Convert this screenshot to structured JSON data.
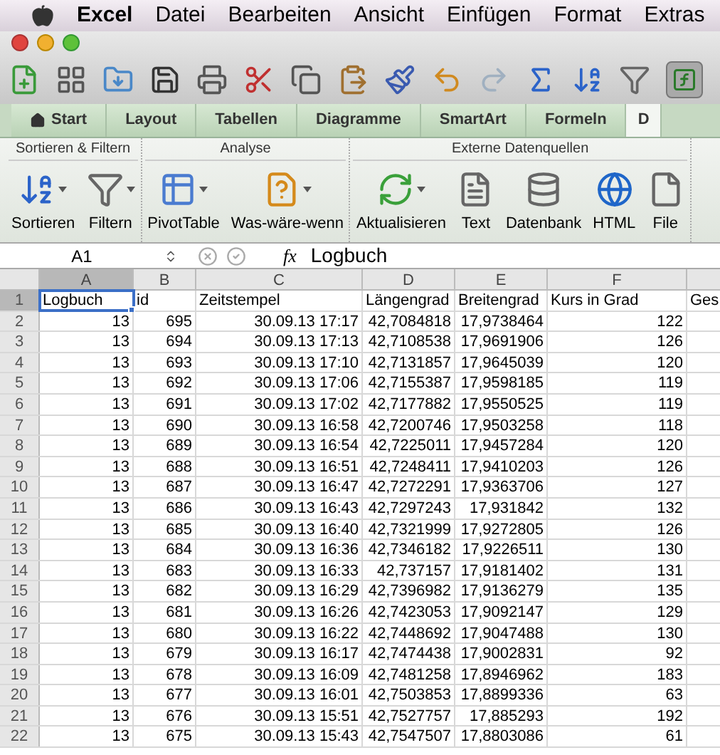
{
  "menu_bar": {
    "app": "Excel",
    "items": [
      "Datei",
      "Bearbeiten",
      "Ansicht",
      "Einfügen",
      "Format",
      "Extras"
    ]
  },
  "ribbon_tabs": [
    {
      "label": "Start",
      "kind": "home",
      "selected": false
    },
    {
      "label": "Layout",
      "kind": "plain",
      "selected": false
    },
    {
      "label": "Tabellen",
      "kind": "plain",
      "selected": false
    },
    {
      "label": "Diagramme",
      "kind": "plain",
      "selected": false
    },
    {
      "label": "SmartArt",
      "kind": "plain",
      "selected": false
    },
    {
      "label": "Formeln",
      "kind": "plain",
      "selected": false
    },
    {
      "label": "D",
      "kind": "plain",
      "selected": true
    }
  ],
  "ribbon_groups": [
    {
      "title": "Sortieren & Filtern",
      "buttons": [
        {
          "label": "Sortieren",
          "kind": "sort",
          "dropdown": true
        },
        {
          "label": "Filtern",
          "kind": "filter",
          "dropdown": true
        }
      ]
    },
    {
      "title": "Analyse",
      "buttons": [
        {
          "label": "PivotTable",
          "kind": "pivot",
          "dropdown": true
        },
        {
          "label": "Was-wäre-wenn",
          "kind": "whatif",
          "dropdown": true
        }
      ]
    },
    {
      "title": "Externe Datenquellen",
      "buttons": [
        {
          "label": "Aktualisieren",
          "kind": "refresh",
          "dropdown": true
        },
        {
          "label": "Text",
          "kind": "text",
          "dropdown": false
        },
        {
          "label": "Datenbank",
          "kind": "database",
          "dropdown": false
        },
        {
          "label": "HTML",
          "kind": "html",
          "dropdown": false
        },
        {
          "label": "File",
          "kind": "file",
          "dropdown": false
        }
      ]
    }
  ],
  "formula_bar": {
    "cell_ref": "A1",
    "function_label": "fx",
    "value": "Logbuch"
  },
  "sheet": {
    "columns": [
      {
        "letter": "A",
        "selected": true
      },
      {
        "letter": "B",
        "selected": false
      },
      {
        "letter": "C",
        "selected": false
      },
      {
        "letter": "D",
        "selected": false
      },
      {
        "letter": "E",
        "selected": false
      },
      {
        "letter": "F",
        "selected": false
      }
    ],
    "rows": [
      {
        "number": "1",
        "selected": true,
        "kind": "text",
        "cells": [
          "Logbuch",
          "id",
          "Zeitstempel",
          "Längengrad",
          "Breitengrad",
          "Kurs in Grad",
          "Ges"
        ]
      },
      {
        "number": "2",
        "selected": false,
        "kind": "number",
        "cells": [
          "13",
          "695",
          "30.09.13 17:17",
          "42,7084818",
          "17,9738464",
          "122"
        ]
      },
      {
        "number": "3",
        "selected": false,
        "kind": "number",
        "cells": [
          "13",
          "694",
          "30.09.13 17:13",
          "42,7108538",
          "17,9691906",
          "126"
        ]
      },
      {
        "number": "4",
        "selected": false,
        "kind": "number",
        "cells": [
          "13",
          "693",
          "30.09.13 17:10",
          "42,7131857",
          "17,9645039",
          "120"
        ]
      },
      {
        "number": "5",
        "selected": false,
        "kind": "number",
        "cells": [
          "13",
          "692",
          "30.09.13 17:06",
          "42,7155387",
          "17,9598185",
          "119"
        ]
      },
      {
        "number": "6",
        "selected": false,
        "kind": "number",
        "cells": [
          "13",
          "691",
          "30.09.13 17:02",
          "42,7177882",
          "17,9550525",
          "119"
        ]
      },
      {
        "number": "7",
        "selected": false,
        "kind": "number",
        "cells": [
          "13",
          "690",
          "30.09.13 16:58",
          "42,7200746",
          "17,9503258",
          "118"
        ]
      },
      {
        "number": "8",
        "selected": false,
        "kind": "number",
        "cells": [
          "13",
          "689",
          "30.09.13 16:54",
          "42,7225011",
          "17,9457284",
          "120"
        ]
      },
      {
        "number": "9",
        "selected": false,
        "kind": "number",
        "cells": [
          "13",
          "688",
          "30.09.13 16:51",
          "42,7248411",
          "17,9410203",
          "126"
        ]
      },
      {
        "number": "10",
        "selected": false,
        "kind": "number",
        "cells": [
          "13",
          "687",
          "30.09.13 16:47",
          "42,7272291",
          "17,9363706",
          "127"
        ]
      },
      {
        "number": "11",
        "selected": false,
        "kind": "number",
        "cells": [
          "13",
          "686",
          "30.09.13 16:43",
          "42,7297243",
          "17,931842",
          "132"
        ]
      },
      {
        "number": "12",
        "selected": false,
        "kind": "number",
        "cells": [
          "13",
          "685",
          "30.09.13 16:40",
          "42,7321999",
          "17,9272805",
          "126"
        ]
      },
      {
        "number": "13",
        "selected": false,
        "kind": "number",
        "cells": [
          "13",
          "684",
          "30.09.13 16:36",
          "42,7346182",
          "17,9226511",
          "130"
        ]
      },
      {
        "number": "14",
        "selected": false,
        "kind": "number",
        "cells": [
          "13",
          "683",
          "30.09.13 16:33",
          "42,737157",
          "17,9181402",
          "131"
        ]
      },
      {
        "number": "15",
        "selected": false,
        "kind": "number",
        "cells": [
          "13",
          "682",
          "30.09.13 16:29",
          "42,7396982",
          "17,9136279",
          "135"
        ]
      },
      {
        "number": "16",
        "selected": false,
        "kind": "number",
        "cells": [
          "13",
          "681",
          "30.09.13 16:26",
          "42,7423053",
          "17,9092147",
          "129"
        ]
      },
      {
        "number": "17",
        "selected": false,
        "kind": "number",
        "cells": [
          "13",
          "680",
          "30.09.13 16:22",
          "42,7448692",
          "17,9047488",
          "130"
        ]
      },
      {
        "number": "18",
        "selected": false,
        "kind": "number",
        "cells": [
          "13",
          "679",
          "30.09.13 16:17",
          "42,7474438",
          "17,9002831",
          "92"
        ]
      },
      {
        "number": "19",
        "selected": false,
        "kind": "number",
        "cells": [
          "13",
          "678",
          "30.09.13 16:09",
          "42,7481258",
          "17,8946962",
          "183"
        ]
      },
      {
        "number": "20",
        "selected": false,
        "kind": "number",
        "cells": [
          "13",
          "677",
          "30.09.13 16:01",
          "42,7503853",
          "17,8899336",
          "63"
        ]
      },
      {
        "number": "21",
        "selected": false,
        "kind": "number",
        "cells": [
          "13",
          "676",
          "30.09.13 15:51",
          "42,7527757",
          "17,885293",
          "192"
        ]
      },
      {
        "number": "22",
        "selected": false,
        "kind": "number",
        "cells": [
          "13",
          "675",
          "30.09.13 15:43",
          "42,7547507",
          "17,8803086",
          "61"
        ]
      }
    ]
  }
}
